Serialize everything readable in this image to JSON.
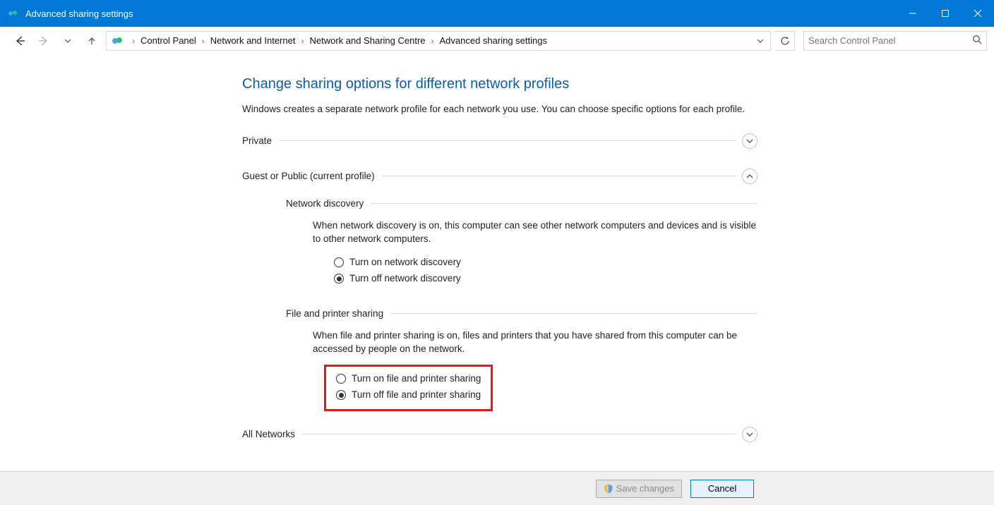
{
  "window": {
    "title": "Advanced sharing settings"
  },
  "breadcrumb": {
    "items": [
      "Control Panel",
      "Network and Internet",
      "Network and Sharing Centre",
      "Advanced sharing settings"
    ]
  },
  "search": {
    "placeholder": "Search Control Panel"
  },
  "page": {
    "heading": "Change sharing options for different network profiles",
    "intro": "Windows creates a separate network profile for each network you use. You can choose specific options for each profile."
  },
  "profiles": {
    "private": {
      "label": "Private"
    },
    "public": {
      "label": "Guest or Public (current profile)"
    },
    "all": {
      "label": "All Networks"
    }
  },
  "network_discovery": {
    "title": "Network discovery",
    "description": "When network discovery is on, this computer can see other network computers and devices and is visible to other network computers.",
    "on_label": "Turn on network discovery",
    "off_label": "Turn off network discovery",
    "selected": "off"
  },
  "file_printer": {
    "title": "File and printer sharing",
    "description": "When file and printer sharing is on, files and printers that you have shared from this computer can be accessed by people on the network.",
    "on_label": "Turn on file and printer sharing",
    "off_label": "Turn off file and printer sharing",
    "selected": "off"
  },
  "footer": {
    "save_label": "Save changes",
    "cancel_label": "Cancel"
  },
  "colors": {
    "accent": "#0078d7",
    "heading": "#0b5cab",
    "highlight_border": "#e21a1a"
  }
}
